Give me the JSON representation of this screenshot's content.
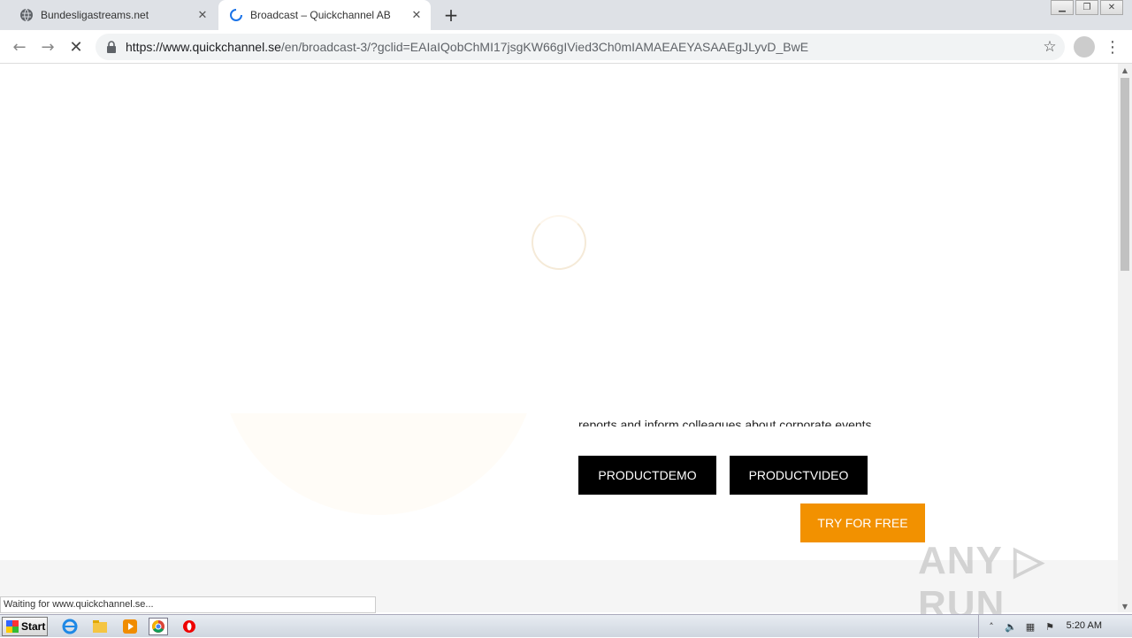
{
  "browser": {
    "tabs": [
      {
        "title": "Bundesligastreams.net",
        "active": false
      },
      {
        "title": "Broadcast – Quickchannel AB",
        "active": true
      }
    ],
    "url_host": "https://www.quickchannel.se",
    "url_path": "/en/broadcast-3/?gclid=EAIaIQobChMI17jsgKW66gIVied3Ch0mIAMAEAEYASAAEgJLyvD_BwE",
    "status_text": "Waiting for www.quickchannel.se..."
  },
  "page": {
    "hero_text": "reports and inform colleagues about corporate events.",
    "buttons": {
      "demo": "PRODUCTDEMO",
      "video": "PRODUCTVIDEO",
      "trial": "TRY FOR FREE"
    },
    "accent_color": "#f29100"
  },
  "watermark": "ANY ▷ RUN",
  "taskbar": {
    "start_label": "Start",
    "clock": "5:20 AM"
  }
}
